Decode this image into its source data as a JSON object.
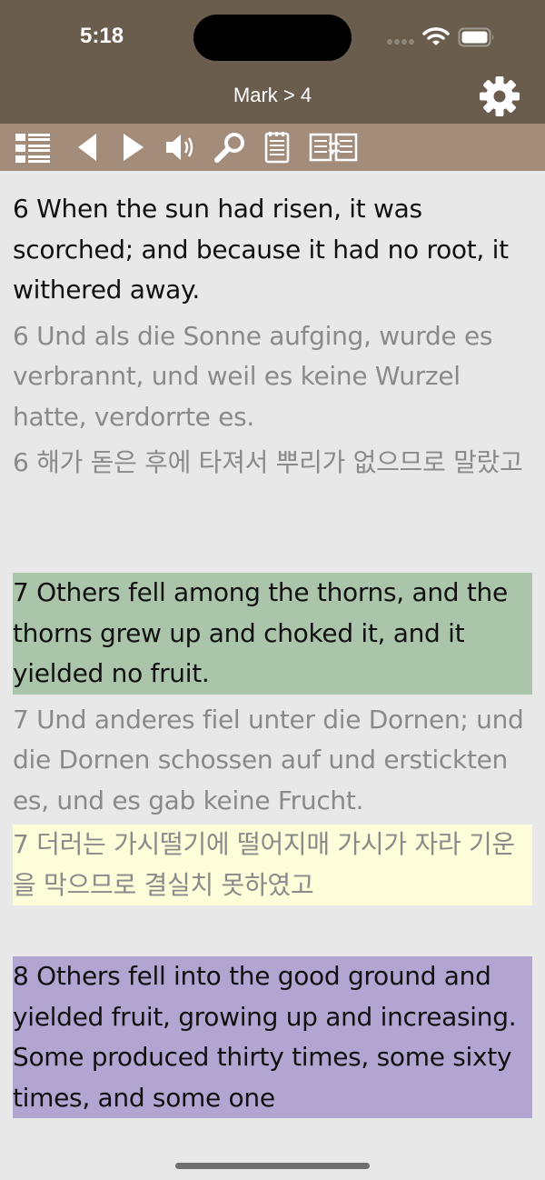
{
  "status_bar": {
    "time": "5:18"
  },
  "nav": {
    "title": "Mark > 4"
  },
  "toolbar": {
    "buttons": [
      "list-icon",
      "back-icon",
      "forward-icon",
      "speaker-icon",
      "search-icon",
      "notes-icon",
      "compare-icon"
    ]
  },
  "verses": [
    {
      "en": "6  When the sun had risen, it was scorched; and because it had no root, it withered away.",
      "de": "6  Und als die Sonne aufging, wurde es verbrannt, und weil es keine Wurzel hatte, verdorrte es.",
      "ko": "6  해가 돋은 후에 타져서 뿌리가 없으므로 말랐고"
    },
    {
      "en": "7  Others fell among the thorns, and the thorns grew up and choked it, and it yielded no fruit.",
      "de": "7  Und anderes fiel unter die Dornen; und die Dornen schossen auf und erstickten es, und es gab keine Frucht.",
      "ko": "7  더러는 가시떨기에 떨어지매 가시가 자라 기운을 막으므로 결실치 못하였고"
    },
    {
      "en": "8  Others fell into the good ground and yielded fruit, growing up and increasing. Some produced thirty times, some sixty times, and some one"
    }
  ],
  "colors": {
    "nav_bg": "#6b5d4e",
    "toolbar_bg": "#a48c7b",
    "highlight_green": "#abc5aa",
    "highlight_yellow": "#fdfed9",
    "highlight_purple": "#b2a5d2"
  }
}
